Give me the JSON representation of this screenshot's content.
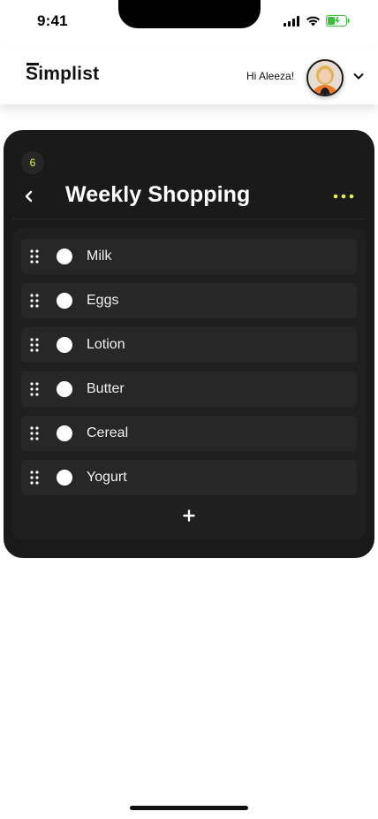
{
  "status_bar": {
    "time": "9:41",
    "icons": [
      "signal-icon",
      "wifi-icon",
      "battery-icon"
    ]
  },
  "header": {
    "logo": "Simplist",
    "greeting": "Hi Aleeza!",
    "avatar_icon": "avatar",
    "menu_icon": "chevron-down-icon"
  },
  "list": {
    "count": "6",
    "title": "Weekly Shopping",
    "back_icon": "chevron-left-icon",
    "more_icon": "more-dots-icon",
    "add_icon": "plus-icon",
    "accent_color": "#E6F04A",
    "items": [
      {
        "label": "Milk"
      },
      {
        "label": "Eggs"
      },
      {
        "label": "Lotion"
      },
      {
        "label": "Butter"
      },
      {
        "label": "Cereal"
      },
      {
        "label": "Yogurt"
      }
    ]
  },
  "colors": {
    "card_bg": "#1A1A1A",
    "item_bg": "#272727",
    "text_light": "#F1F1F1"
  }
}
